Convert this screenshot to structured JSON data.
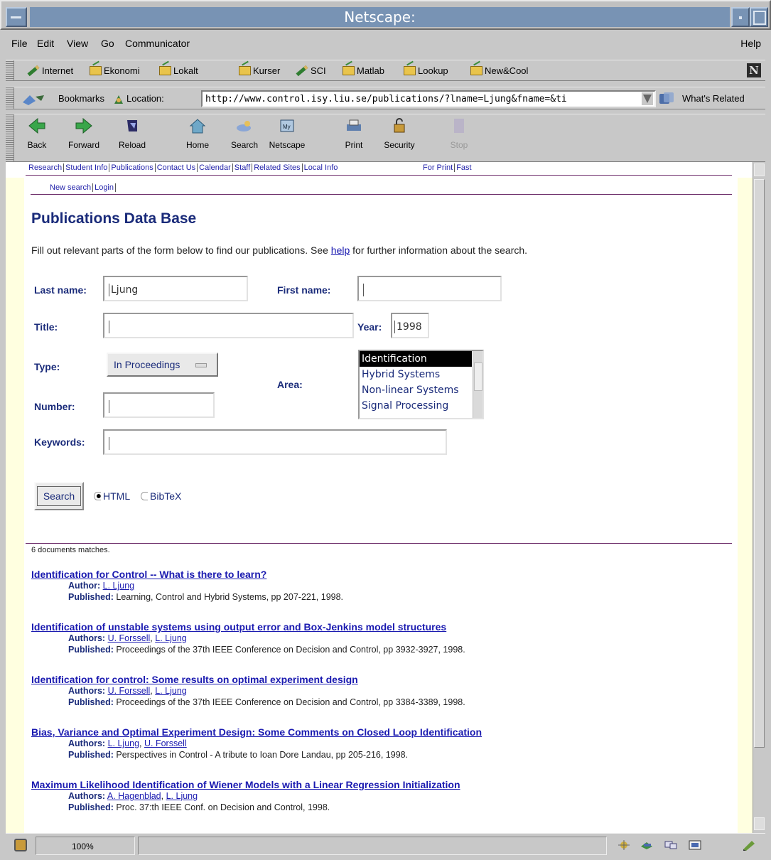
{
  "window": {
    "title": "Netscape:"
  },
  "menubar": {
    "items": [
      "File",
      "Edit",
      "View",
      "Go",
      "Communicator"
    ],
    "help": "Help"
  },
  "personal_toolbar": {
    "items": [
      "Internet",
      "Ekonomi",
      "Lokalt",
      "Kurser",
      "SCI",
      "Matlab",
      "Lookup",
      "New&Cool"
    ],
    "logo": "N"
  },
  "location_bar": {
    "bookmarks": "Bookmarks",
    "location_label": "Location:",
    "url": "http://www.control.isy.liu.se/publications/?lname=Ljung&fname=&ti",
    "whats_related": "What's Related"
  },
  "nav_toolbar": {
    "buttons": [
      "Back",
      "Forward",
      "Reload",
      "Home",
      "Search",
      "Netscape",
      "Print",
      "Security",
      "Stop"
    ]
  },
  "site_nav": {
    "items": [
      "Research",
      "Student Info",
      "Publications",
      "Contact Us",
      "Calendar",
      "Staff",
      "Related Sites",
      "Local Info"
    ],
    "right_items": [
      "For Print",
      "Fast"
    ],
    "sub_items": [
      "New search",
      "Login"
    ]
  },
  "page": {
    "title": "Publications Data Base",
    "intro_before": "Fill out relevant parts of the form below to find our publications. See ",
    "intro_link": "help",
    "intro_after": " for further information about the search."
  },
  "form": {
    "last_name_label": "Last name:",
    "last_name_value": "Ljung",
    "first_name_label": "First name:",
    "first_name_value": "",
    "title_label": "Title:",
    "title_value": "",
    "year_label": "Year:",
    "year_value": "1998",
    "type_label": "Type:",
    "type_value": "In Proceedings",
    "area_label": "Area:",
    "area_options": [
      "Identification",
      "Hybrid Systems",
      "Non-linear Systems",
      "Signal Processing"
    ],
    "area_selected": "Identification",
    "number_label": "Number:",
    "number_value": "",
    "keywords_label": "Keywords:",
    "keywords_value": "",
    "search_button": "Search",
    "format_options": [
      "HTML",
      "BibTeX"
    ],
    "format_selected": "HTML"
  },
  "results": {
    "count_text": "6 documents matches.",
    "items": [
      {
        "title": "Identification for Control -- What is there to learn?",
        "author_label": "Author:",
        "authors": [
          "L. Ljung"
        ],
        "published_label": "Published:",
        "published": "Learning, Control and Hybrid Systems, pp 207-221, 1998."
      },
      {
        "title": "Identification of unstable systems using output error and Box-Jenkins model structures",
        "author_label": "Authors:",
        "authors": [
          "U. Forssell",
          "L. Ljung"
        ],
        "published_label": "Published:",
        "published": "Proceedings of the 37th IEEE Conference on Decision and Control, pp 3932-3927, 1998."
      },
      {
        "title": "Identification for control: Some results on optimal experiment design",
        "author_label": "Authors:",
        "authors": [
          "U. Forssell",
          "L. Ljung"
        ],
        "published_label": "Published:",
        "published": "Proceedings of the 37th IEEE Conference on Decision and Control, pp 3384-3389, 1998."
      },
      {
        "title": "Bias, Variance and Optimal Experiment Design: Some Comments on Closed Loop Identification",
        "author_label": "Authors:",
        "authors": [
          "L. Ljung",
          "U. Forssell"
        ],
        "published_label": "Published:",
        "published": "Perspectives in Control - A tribute to Ioan Dore Landau, pp 205-216, 1998."
      },
      {
        "title": "Maximum Likelihood Identification of Wiener Models with a Linear Regression Initialization",
        "author_label": "Authors:",
        "authors": [
          "A. Hagenblad",
          "L. Ljung"
        ],
        "published_label": "Published:",
        "published": "Proc. 37:th IEEE Conf. on Decision and Control, 1998."
      }
    ]
  },
  "statusbar": {
    "zoom": "100%"
  },
  "colors": {
    "title_bar": "#7893b4",
    "heading": "#1a2b7a",
    "link": "#1a1ab0",
    "rule": "#6b2a68",
    "margin_strip": "#ffffe0"
  }
}
